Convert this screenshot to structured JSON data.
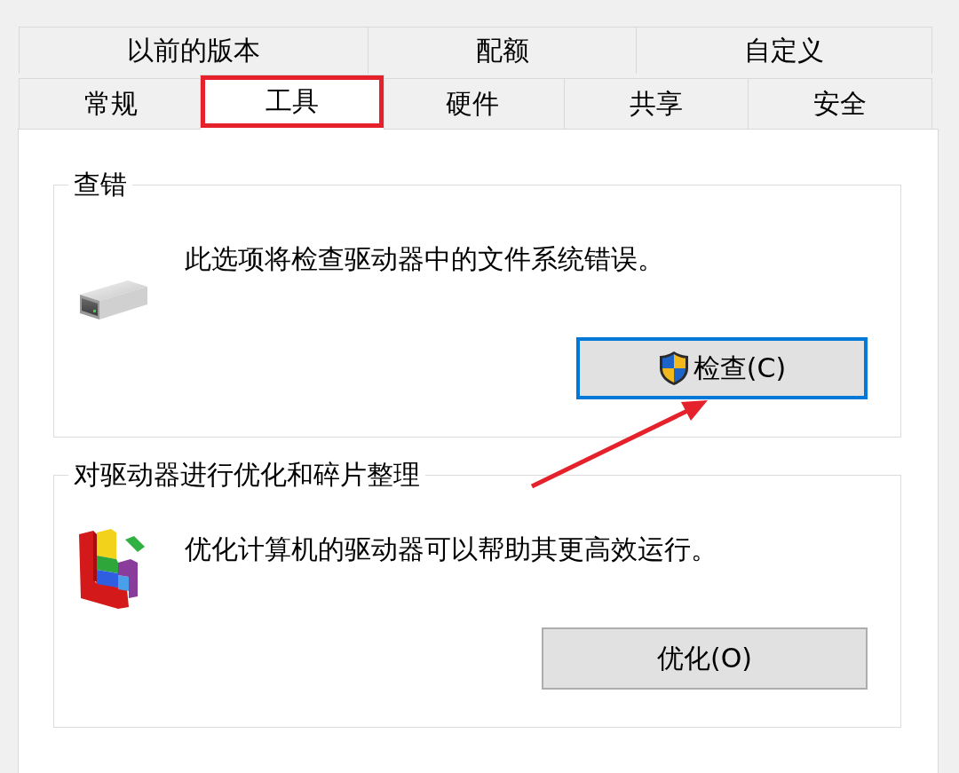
{
  "tab_rows": [
    {
      "tabs": [
        {
          "label": "以前的版本",
          "selected": false,
          "highlighted": false
        },
        {
          "label": "配额",
          "selected": false,
          "highlighted": false
        },
        {
          "label": "自定义",
          "selected": false,
          "highlighted": false
        }
      ]
    },
    {
      "tabs": [
        {
          "label": "常规",
          "selected": false,
          "highlighted": false
        },
        {
          "label": "工具",
          "selected": true,
          "highlighted": true
        },
        {
          "label": "硬件",
          "selected": false,
          "highlighted": false
        },
        {
          "label": "共享",
          "selected": false,
          "highlighted": false
        },
        {
          "label": "安全",
          "selected": false,
          "highlighted": false
        }
      ]
    }
  ],
  "groups": [
    {
      "kind": "drive",
      "title": "查错",
      "description": "此选项将检查驱动器中的文件系统错误。",
      "button": {
        "label": "检查(C)",
        "focused": true,
        "shield": true,
        "pointed_at": true
      }
    },
    {
      "kind": "defrag",
      "title": "对驱动器进行优化和碎片整理",
      "description": "优化计算机的驱动器可以帮助其更高效运行。",
      "button": {
        "label": "优化(O)",
        "focused": false,
        "shield": false,
        "pointed_at": false
      }
    }
  ]
}
